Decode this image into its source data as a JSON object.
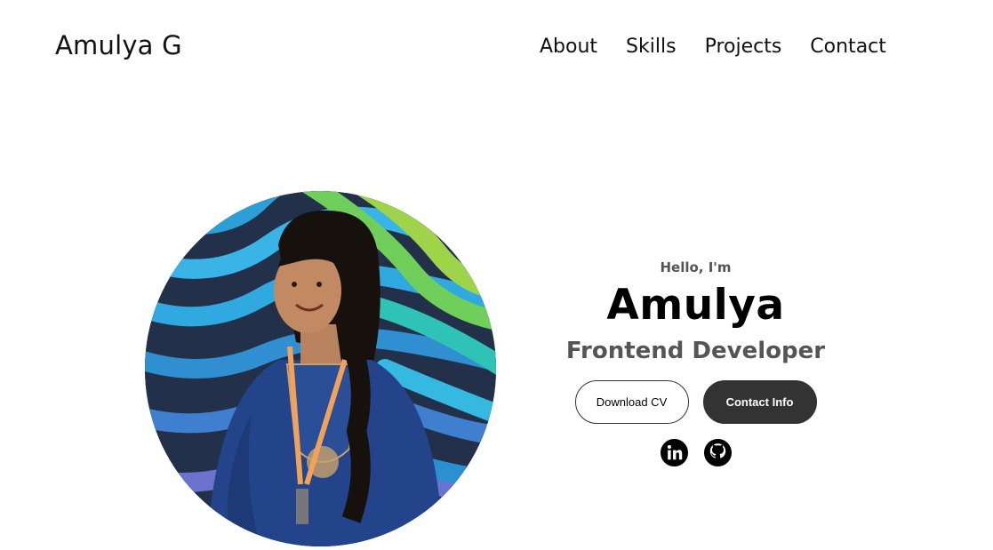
{
  "nav": {
    "logo": "Amulya G",
    "links": [
      "About",
      "Skills",
      "Projects",
      "Contact"
    ]
  },
  "hero": {
    "greeting": "Hello, I'm",
    "name": "Amulya",
    "role": "Frontend Developer",
    "buttons": {
      "download_cv": "Download CV",
      "contact_info": "Contact Info"
    },
    "socials": [
      "linkedin-icon",
      "github-icon"
    ]
  },
  "colors": {
    "text": "#000000",
    "muted": "#555555",
    "button_dark": "#333333",
    "background": "#ffffff"
  }
}
